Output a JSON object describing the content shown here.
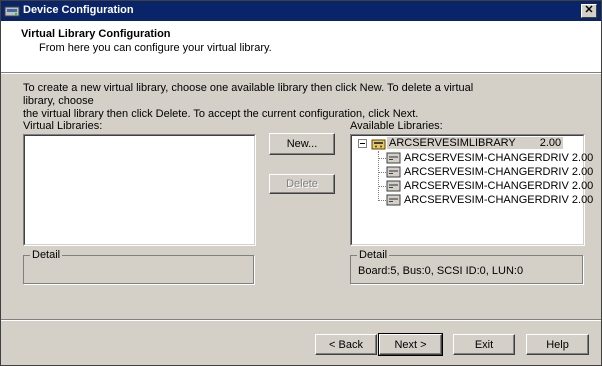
{
  "window": {
    "title": "Device Configuration",
    "close_glyph": "✕"
  },
  "header": {
    "title": "Virtual Library Configuration",
    "subtitle": "From here you can configure your virtual library."
  },
  "instructions": {
    "line1": "To create a new virtual library, choose one available library then click New. To delete a virtual library, choose",
    "line2": "the virtual library then click Delete. To accept the current configuration, click Next."
  },
  "virtual_libraries": {
    "label": "Virtual Libraries:",
    "items": [],
    "detail_label": "Detail",
    "detail_text": ""
  },
  "middle_buttons": {
    "new_label": "New...",
    "delete_label": "Delete"
  },
  "available_libraries": {
    "label": "Available Libraries:",
    "library": {
      "name": "ARCSERVESIMLIBRARY",
      "version": "2.00",
      "icon": "library-icon"
    },
    "drives": [
      {
        "name": "ARCSERVESIM-CHANGERDRIV",
        "version": "2.00",
        "icon": "tape-drive-icon"
      },
      {
        "name": "ARCSERVESIM-CHANGERDRIV",
        "version": "2.00",
        "icon": "tape-drive-icon"
      },
      {
        "name": "ARCSERVESIM-CHANGERDRIV",
        "version": "2.00",
        "icon": "tape-drive-icon"
      },
      {
        "name": "ARCSERVESIM-CHANGERDRIV",
        "version": "2.00",
        "icon": "tape-drive-icon"
      }
    ],
    "detail_label": "Detail",
    "detail_text": "Board:5, Bus:0, SCSI ID:0, LUN:0"
  },
  "footer": {
    "back_label": "< Back",
    "next_label": "Next >",
    "exit_label": "Exit",
    "help_label": "Help"
  }
}
